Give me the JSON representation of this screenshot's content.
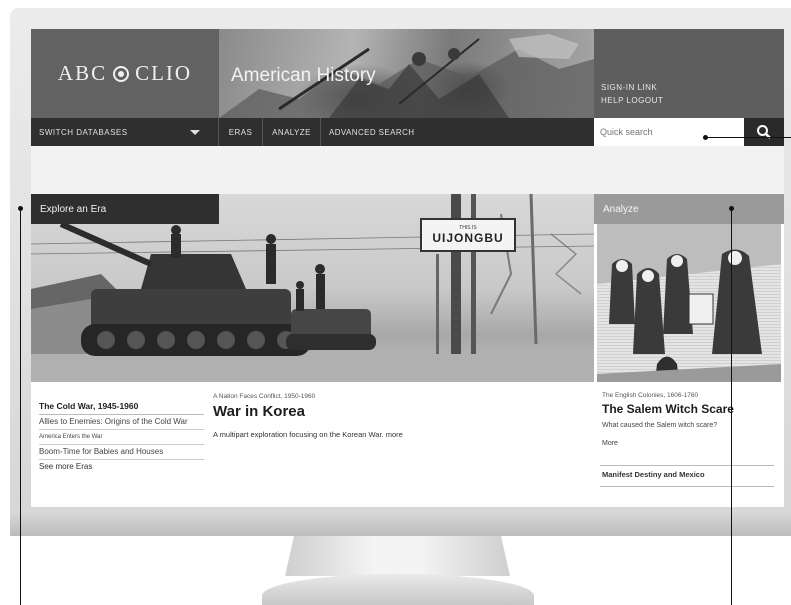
{
  "app": {
    "logo_text": "ABC",
    "logo_text_2": "CLIO",
    "site_title": "American History"
  },
  "utility": {
    "sign_in": "SIGN-IN LINK",
    "help_logout": "HELP  LOGOUT"
  },
  "nav": {
    "databases_label": "SWITCH DATABASES",
    "items": [
      {
        "label": "ERAS"
      },
      {
        "label": "ANALYZE"
      },
      {
        "label": "ADVANCED SEARCH"
      }
    ],
    "search_placeholder": "Quick search"
  },
  "explore": {
    "tab_label": "Explore an Era",
    "sign_small": "THIS IS",
    "sign_text": "UIJONGBU",
    "era_caption": "A Nation Faces Conflict, 1950-1960",
    "feature_title": "War in Korea",
    "feature_desc": "A multipart exploration focusing on the Korean War.",
    "feature_more": "more",
    "list_heading": "The Cold War, 1945-1960",
    "list_items": [
      {
        "label": "Allies to Enemies: Origins of the Cold War",
        "small": false
      },
      {
        "label": "America Enters the War",
        "small": true
      },
      {
        "label": "Boom-Time for Babies and Houses",
        "small": false
      }
    ],
    "see_more": "See more Eras"
  },
  "analyze": {
    "tab_label": "Analyze",
    "era_caption": "The English Colonies, 1606-1760",
    "title": "The Salem Witch Scare",
    "desc": "What caused the Salem witch scare?",
    "more": "More",
    "link": "Manifest Destiny and Mexico"
  },
  "colors": {
    "nav_bg": "#2f2f2f",
    "banner_bg": "#6a6a6a",
    "analyze_tab": "#9a9a9a",
    "page_bg": "#f2f2f2"
  }
}
